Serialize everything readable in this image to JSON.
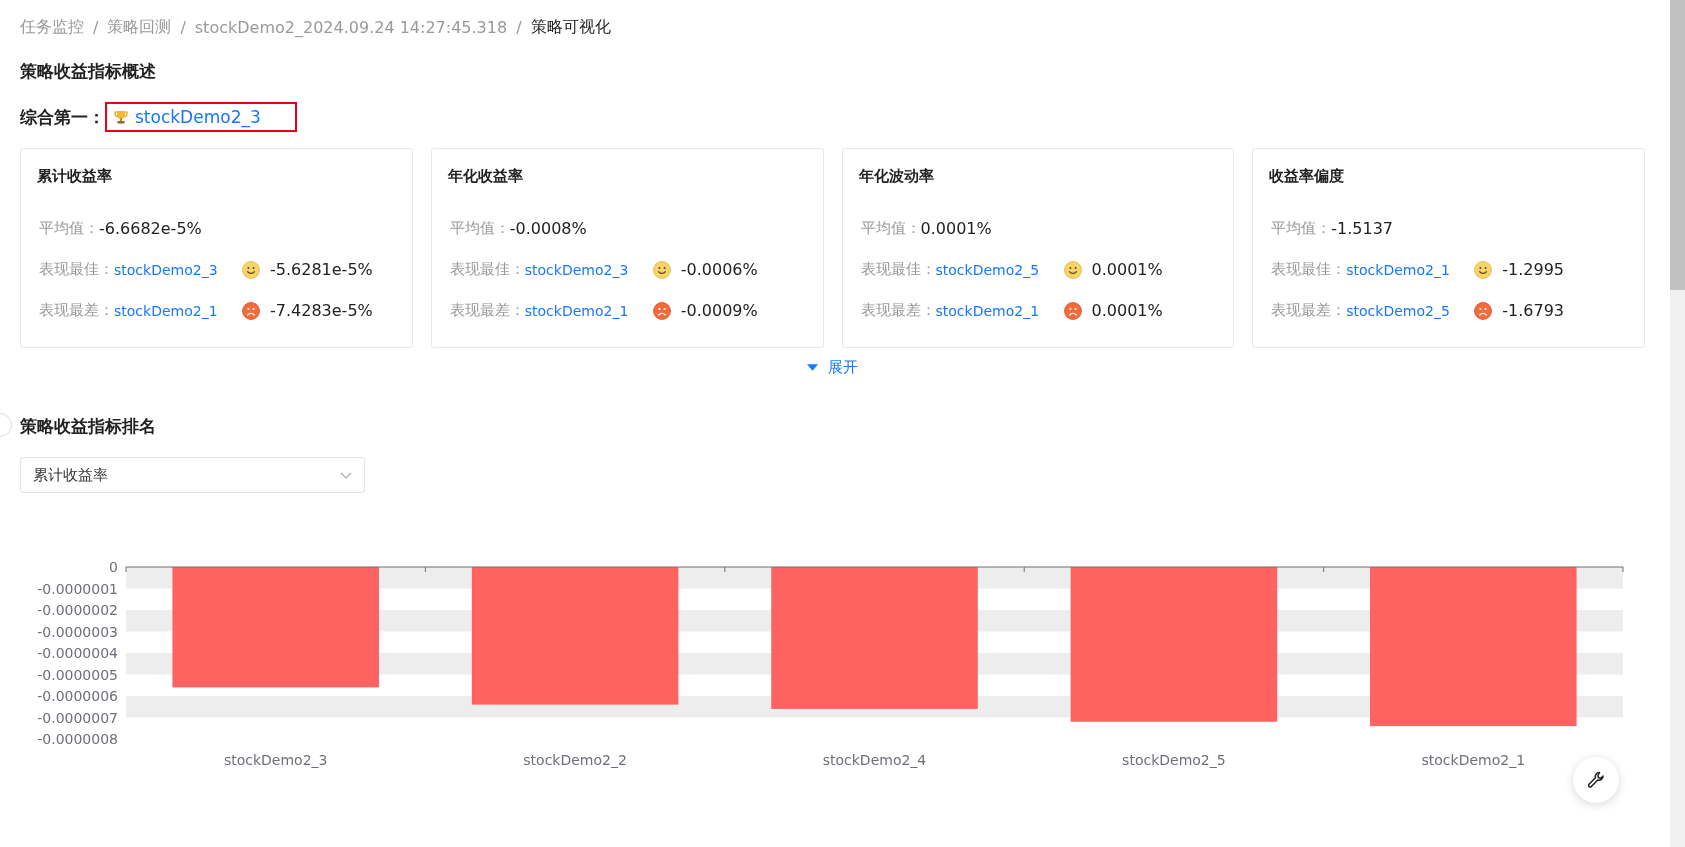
{
  "breadcrumb": [
    {
      "label": "任务监控",
      "separator": "/"
    },
    {
      "label": "策略回测",
      "separator": "/"
    },
    {
      "label": "stockDemo2_2024.09.24 14:27:45.318",
      "separator": "/"
    },
    {
      "label": "策略可视化"
    }
  ],
  "overview": {
    "title": "策略收益指标概述",
    "top_label": "综合第一：",
    "top_name": "stockDemo2_3"
  },
  "cards": [
    {
      "title": "累计收益率",
      "avg_label": "平均值：",
      "avg_value": "-6.6682e-5%",
      "rows": [
        {
          "kind": "best",
          "label": "表现最佳：",
          "name": "stockDemo2_3",
          "value": "-5.6281e-5%"
        },
        {
          "kind": "worst",
          "label": "表现最差：",
          "name": "stockDemo2_1",
          "value": "-7.4283e-5%"
        }
      ]
    },
    {
      "title": "年化收益率",
      "avg_label": "平均值：",
      "avg_value": "-0.0008%",
      "rows": [
        {
          "kind": "best",
          "label": "表现最佳：",
          "name": "stockDemo2_3",
          "value": "-0.0006%"
        },
        {
          "kind": "worst",
          "label": "表现最差：",
          "name": "stockDemo2_1",
          "value": "-0.0009%"
        }
      ]
    },
    {
      "title": "年化波动率",
      "avg_label": "平均值：",
      "avg_value": "0.0001%",
      "rows": [
        {
          "kind": "best",
          "label": "表现最佳：",
          "name": "stockDemo2_5",
          "value": "0.0001%"
        },
        {
          "kind": "worst",
          "label": "表现最差：",
          "name": "stockDemo2_1",
          "value": "0.0001%"
        }
      ]
    },
    {
      "title": "收益率偏度",
      "avg_label": "平均值：",
      "avg_value": "-1.5137",
      "rows": [
        {
          "kind": "best",
          "label": "表现最佳：",
          "name": "stockDemo2_1",
          "value": "-1.2995"
        },
        {
          "kind": "worst",
          "label": "表现最差：",
          "name": "stockDemo2_5",
          "value": "-1.6793"
        }
      ]
    }
  ],
  "expand": {
    "label": "展开",
    "expanded": false
  },
  "ranking": {
    "title": "策略收益指标排名",
    "select": {
      "value": "累计收益率"
    },
    "chart_data": {
      "type": "bar",
      "categories": [
        "stockDemo2_3",
        "stockDemo2_2",
        "stockDemo2_4",
        "stockDemo2_5",
        "stockDemo2_1"
      ],
      "series": [
        {
          "color": "#ff6361",
          "values": [
            -5.6e-07,
            -6.4e-07,
            -6.6e-07,
            -7.2e-07,
            -7.4e-07
          ]
        }
      ],
      "ylim": [
        -8e-07,
        0
      ],
      "yticks": [
        {
          "value": 0,
          "label": "0"
        },
        {
          "value": -1e-07,
          "label": "-0.0000001"
        },
        {
          "value": -2e-07,
          "label": "-0.0000002"
        },
        {
          "value": -3e-07,
          "label": "-0.0000003"
        },
        {
          "value": -4e-07,
          "label": "-0.0000004"
        },
        {
          "value": -5e-07,
          "label": "-0.0000005"
        },
        {
          "value": -6e-07,
          "label": "-0.0000006"
        },
        {
          "value": -7e-07,
          "label": "-0.0000007"
        },
        {
          "value": -8e-07,
          "label": "-0.0000008"
        }
      ]
    }
  }
}
